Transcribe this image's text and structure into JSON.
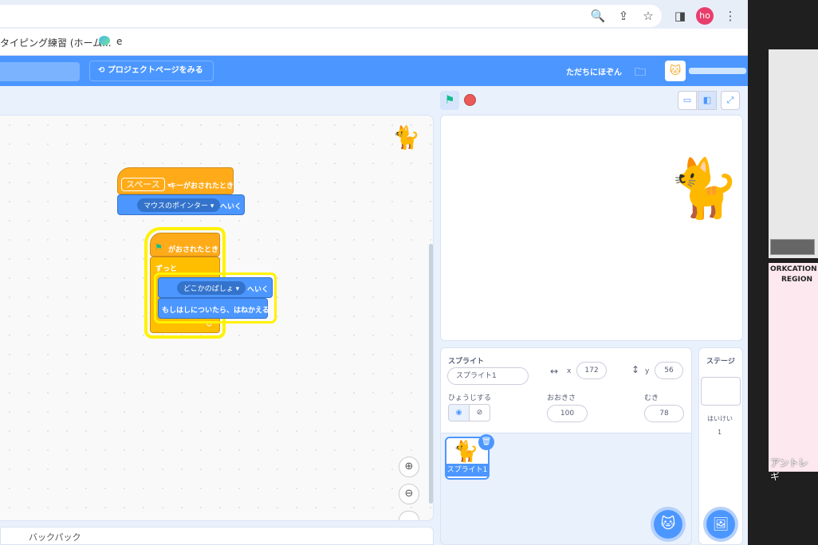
{
  "browser": {
    "profile_initials": "ho",
    "bookmarks": [
      "タイピング練習 (ホーム...",
      "e"
    ]
  },
  "menubar": {
    "project_page_button": "プロジェクトページをみる",
    "share_label": "ただちにほぞん"
  },
  "blocks": {
    "key_hat_key": "スペース",
    "key_hat_text": "キーがおされたとき",
    "goto_target": "マウスのポインター",
    "goto_suffix": "へいく",
    "flag_hat_text": "がおされたとき",
    "forever_label": "ずっと",
    "goto2_target": "どこかのばしょ",
    "goto2_suffix": "へいく",
    "bounce_label": "もしはしについたら、はねかえる"
  },
  "sprite_info": {
    "sprite_label": "スプライト",
    "sprite_name": "スプライト1",
    "x_label": "x",
    "x_value": "172",
    "y_label": "y",
    "y_value": "56",
    "show_label": "ひょうじする",
    "size_label": "おおきさ",
    "size_value": "100",
    "direction_label": "むき",
    "direction_value": "78"
  },
  "sprite_list": {
    "items": [
      {
        "name": "スプライト1"
      }
    ]
  },
  "stage_pane": {
    "label": "ステージ",
    "backdrop_label": "はいけい",
    "backdrop_count": "1"
  },
  "backpack_label": "バックパック",
  "side_panel": {
    "video2_text1": "ORKCATION",
    "video2_text2": "REGION",
    "video2_name": "アントレ ギ"
  }
}
